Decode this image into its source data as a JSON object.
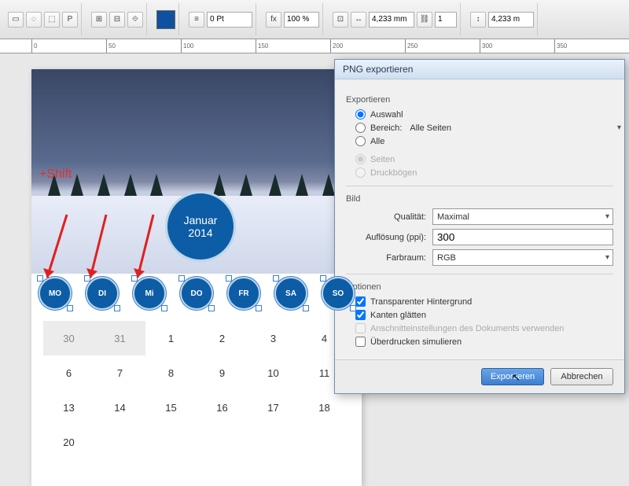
{
  "toolbar": {
    "stroke_pt": "0 Pt",
    "zoom": "100 %",
    "dim_w": "4,233 mm",
    "dim_h": "4,233 m",
    "count": "1"
  },
  "ruler": [
    "0",
    "50",
    "100",
    "150",
    "200",
    "250",
    "300",
    "350"
  ],
  "annotation": {
    "shift": "+Shift"
  },
  "month": {
    "name": "Januar",
    "year": "2014"
  },
  "days": [
    "MO",
    "DI",
    "Mi",
    "DO",
    "FR",
    "SA",
    "SO"
  ],
  "calendar": [
    [
      "30",
      "31",
      "1",
      "2",
      "3",
      "4"
    ],
    [
      "6",
      "7",
      "8",
      "9",
      "10",
      "11"
    ],
    [
      "13",
      "14",
      "15",
      "16",
      "17",
      "18"
    ],
    [
      "20",
      "",
      "",
      "",
      "",
      ""
    ]
  ],
  "dialog": {
    "title": "PNG exportieren",
    "export_label": "Exportieren",
    "radio_auswahl": "Auswahl",
    "radio_bereich": "Bereich:",
    "bereich_value": "Alle Seiten",
    "radio_alle": "Alle",
    "radio_seiten": "Seiten",
    "radio_druckboegen": "Druckbögen",
    "image_label": "Bild",
    "quality_label": "Qualität:",
    "quality_value": "Maximal",
    "resolution_label": "Auflösung (ppi):",
    "resolution_value": "300",
    "colorspace_label": "Farbraum:",
    "colorspace_value": "RGB",
    "options_label": "Optionen",
    "opt_transparent": "Transparenter Hintergrund",
    "opt_smooth": "Kanten glätten",
    "opt_bleed": "Anschnitteinstellungen des Dokuments verwenden",
    "opt_overprint": "Überdrucken simulieren",
    "btn_export": "Exportieren",
    "btn_cancel": "Abbrechen"
  }
}
